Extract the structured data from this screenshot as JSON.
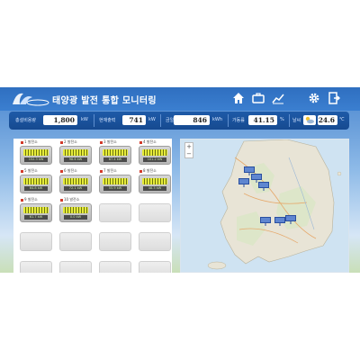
{
  "header": {
    "title": "태양광 발전 통합 모니터링",
    "nav_icons": [
      "home-icon",
      "briefcase-icon",
      "chart-icon",
      "gear-icon",
      "logout-icon"
    ]
  },
  "stats": [
    {
      "label": "총설비용량",
      "value": "1,800",
      "unit": "kW"
    },
    {
      "label": "현재출력",
      "value": "741",
      "unit": "kW"
    },
    {
      "label": "금일발전량",
      "value": "846",
      "unit": "kWh"
    },
    {
      "label": "가동률",
      "value": "41.15",
      "unit": "%"
    },
    {
      "label": "날씨",
      "value": "24.6",
      "unit": "℃",
      "icon": "cloud-sun-icon"
    }
  ],
  "sites": [
    {
      "name": "1 발전소",
      "readout": "152.3 kW",
      "active": true
    },
    {
      "name": "2 발전소",
      "readout": "98.6 kW",
      "active": true
    },
    {
      "name": "3 발전소",
      "readout": "87.4 kW",
      "active": true
    },
    {
      "name": "4 발전소",
      "readout": "101.2 kW",
      "active": true
    },
    {
      "name": "5 발전소",
      "readout": "64.8 kW",
      "active": true
    },
    {
      "name": "6 발전소",
      "readout": "72.1 kW",
      "active": true
    },
    {
      "name": "7 발전소",
      "readout": "55.9 kW",
      "active": true
    },
    {
      "name": "8 발전소",
      "readout": "48.3 kW",
      "active": true
    },
    {
      "name": "9 발전소",
      "readout": "61.7 kW",
      "active": true
    },
    {
      "name": "10 발전소",
      "readout": "0.0 kW",
      "active": true
    }
  ],
  "map": {
    "zoom_in": "+",
    "zoom_out": "−",
    "marker_count": 7,
    "colors": {
      "sea": "#cfe3f2",
      "land": "#e8e4d6",
      "marker": "#2a4fa0"
    }
  }
}
